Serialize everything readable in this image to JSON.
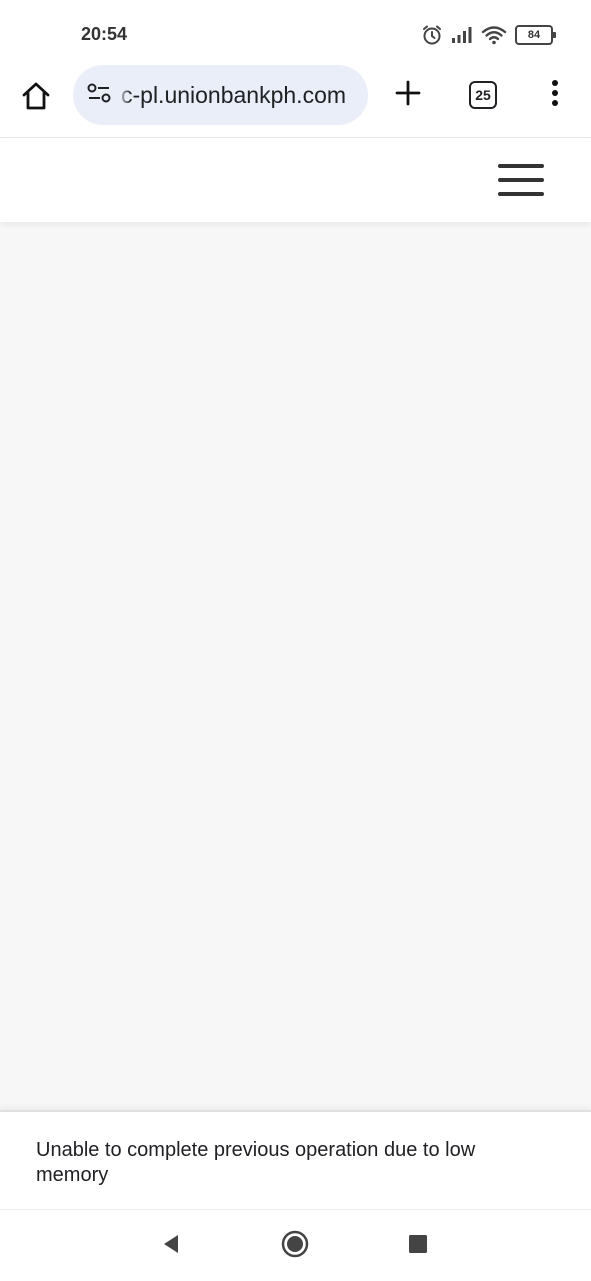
{
  "status_bar": {
    "time": "20:54",
    "battery_level": "84",
    "icons": [
      "alarm-icon",
      "signal-icon",
      "wifi-icon",
      "battery-icon"
    ]
  },
  "browser": {
    "url": "c-pl.unionbankph.com",
    "tab_count": "25",
    "icons": [
      "home-icon",
      "site-info-icon",
      "plus-icon",
      "tab-switcher-icon",
      "more-vert-icon"
    ],
    "omnibox_color": "#e9eef8"
  },
  "page": {
    "menu_icon": "hamburger-icon",
    "body_color": "#f7f7f7"
  },
  "snackbar": {
    "message": "Unable to complete previous operation due to low memory"
  },
  "nav_bar": {
    "icons": [
      "back-icon",
      "home-circle-icon",
      "recents-icon"
    ]
  }
}
